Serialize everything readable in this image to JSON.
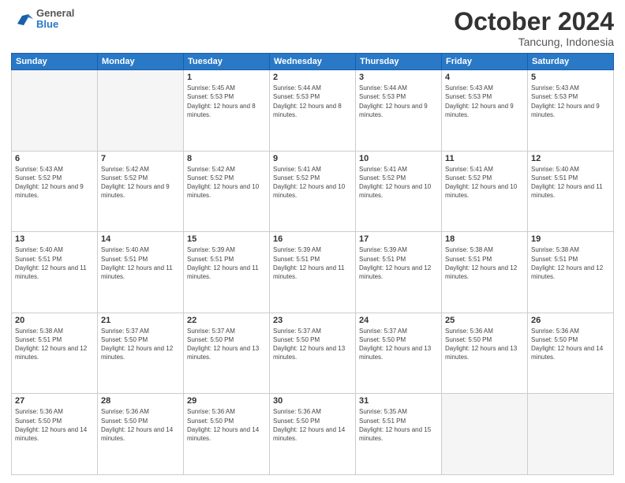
{
  "header": {
    "logo_general": "General",
    "logo_blue": "Blue",
    "month": "October 2024",
    "location": "Tancung, Indonesia"
  },
  "days_of_week": [
    "Sunday",
    "Monday",
    "Tuesday",
    "Wednesday",
    "Thursday",
    "Friday",
    "Saturday"
  ],
  "weeks": [
    [
      {
        "day": "",
        "sunrise": "",
        "sunset": "",
        "daylight": ""
      },
      {
        "day": "",
        "sunrise": "",
        "sunset": "",
        "daylight": ""
      },
      {
        "day": "1",
        "sunrise": "Sunrise: 5:45 AM",
        "sunset": "Sunset: 5:53 PM",
        "daylight": "Daylight: 12 hours and 8 minutes."
      },
      {
        "day": "2",
        "sunrise": "Sunrise: 5:44 AM",
        "sunset": "Sunset: 5:53 PM",
        "daylight": "Daylight: 12 hours and 8 minutes."
      },
      {
        "day": "3",
        "sunrise": "Sunrise: 5:44 AM",
        "sunset": "Sunset: 5:53 PM",
        "daylight": "Daylight: 12 hours and 9 minutes."
      },
      {
        "day": "4",
        "sunrise": "Sunrise: 5:43 AM",
        "sunset": "Sunset: 5:53 PM",
        "daylight": "Daylight: 12 hours and 9 minutes."
      },
      {
        "day": "5",
        "sunrise": "Sunrise: 5:43 AM",
        "sunset": "Sunset: 5:53 PM",
        "daylight": "Daylight: 12 hours and 9 minutes."
      }
    ],
    [
      {
        "day": "6",
        "sunrise": "Sunrise: 5:43 AM",
        "sunset": "Sunset: 5:52 PM",
        "daylight": "Daylight: 12 hours and 9 minutes."
      },
      {
        "day": "7",
        "sunrise": "Sunrise: 5:42 AM",
        "sunset": "Sunset: 5:52 PM",
        "daylight": "Daylight: 12 hours and 9 minutes."
      },
      {
        "day": "8",
        "sunrise": "Sunrise: 5:42 AM",
        "sunset": "Sunset: 5:52 PM",
        "daylight": "Daylight: 12 hours and 10 minutes."
      },
      {
        "day": "9",
        "sunrise": "Sunrise: 5:41 AM",
        "sunset": "Sunset: 5:52 PM",
        "daylight": "Daylight: 12 hours and 10 minutes."
      },
      {
        "day": "10",
        "sunrise": "Sunrise: 5:41 AM",
        "sunset": "Sunset: 5:52 PM",
        "daylight": "Daylight: 12 hours and 10 minutes."
      },
      {
        "day": "11",
        "sunrise": "Sunrise: 5:41 AM",
        "sunset": "Sunset: 5:52 PM",
        "daylight": "Daylight: 12 hours and 10 minutes."
      },
      {
        "day": "12",
        "sunrise": "Sunrise: 5:40 AM",
        "sunset": "Sunset: 5:51 PM",
        "daylight": "Daylight: 12 hours and 11 minutes."
      }
    ],
    [
      {
        "day": "13",
        "sunrise": "Sunrise: 5:40 AM",
        "sunset": "Sunset: 5:51 PM",
        "daylight": "Daylight: 12 hours and 11 minutes."
      },
      {
        "day": "14",
        "sunrise": "Sunrise: 5:40 AM",
        "sunset": "Sunset: 5:51 PM",
        "daylight": "Daylight: 12 hours and 11 minutes."
      },
      {
        "day": "15",
        "sunrise": "Sunrise: 5:39 AM",
        "sunset": "Sunset: 5:51 PM",
        "daylight": "Daylight: 12 hours and 11 minutes."
      },
      {
        "day": "16",
        "sunrise": "Sunrise: 5:39 AM",
        "sunset": "Sunset: 5:51 PM",
        "daylight": "Daylight: 12 hours and 11 minutes."
      },
      {
        "day": "17",
        "sunrise": "Sunrise: 5:39 AM",
        "sunset": "Sunset: 5:51 PM",
        "daylight": "Daylight: 12 hours and 12 minutes."
      },
      {
        "day": "18",
        "sunrise": "Sunrise: 5:38 AM",
        "sunset": "Sunset: 5:51 PM",
        "daylight": "Daylight: 12 hours and 12 minutes."
      },
      {
        "day": "19",
        "sunrise": "Sunrise: 5:38 AM",
        "sunset": "Sunset: 5:51 PM",
        "daylight": "Daylight: 12 hours and 12 minutes."
      }
    ],
    [
      {
        "day": "20",
        "sunrise": "Sunrise: 5:38 AM",
        "sunset": "Sunset: 5:51 PM",
        "daylight": "Daylight: 12 hours and 12 minutes."
      },
      {
        "day": "21",
        "sunrise": "Sunrise: 5:37 AM",
        "sunset": "Sunset: 5:50 PM",
        "daylight": "Daylight: 12 hours and 12 minutes."
      },
      {
        "day": "22",
        "sunrise": "Sunrise: 5:37 AM",
        "sunset": "Sunset: 5:50 PM",
        "daylight": "Daylight: 12 hours and 13 minutes."
      },
      {
        "day": "23",
        "sunrise": "Sunrise: 5:37 AM",
        "sunset": "Sunset: 5:50 PM",
        "daylight": "Daylight: 12 hours and 13 minutes."
      },
      {
        "day": "24",
        "sunrise": "Sunrise: 5:37 AM",
        "sunset": "Sunset: 5:50 PM",
        "daylight": "Daylight: 12 hours and 13 minutes."
      },
      {
        "day": "25",
        "sunrise": "Sunrise: 5:36 AM",
        "sunset": "Sunset: 5:50 PM",
        "daylight": "Daylight: 12 hours and 13 minutes."
      },
      {
        "day": "26",
        "sunrise": "Sunrise: 5:36 AM",
        "sunset": "Sunset: 5:50 PM",
        "daylight": "Daylight: 12 hours and 14 minutes."
      }
    ],
    [
      {
        "day": "27",
        "sunrise": "Sunrise: 5:36 AM",
        "sunset": "Sunset: 5:50 PM",
        "daylight": "Daylight: 12 hours and 14 minutes."
      },
      {
        "day": "28",
        "sunrise": "Sunrise: 5:36 AM",
        "sunset": "Sunset: 5:50 PM",
        "daylight": "Daylight: 12 hours and 14 minutes."
      },
      {
        "day": "29",
        "sunrise": "Sunrise: 5:36 AM",
        "sunset": "Sunset: 5:50 PM",
        "daylight": "Daylight: 12 hours and 14 minutes."
      },
      {
        "day": "30",
        "sunrise": "Sunrise: 5:36 AM",
        "sunset": "Sunset: 5:50 PM",
        "daylight": "Daylight: 12 hours and 14 minutes."
      },
      {
        "day": "31",
        "sunrise": "Sunrise: 5:35 AM",
        "sunset": "Sunset: 5:51 PM",
        "daylight": "Daylight: 12 hours and 15 minutes."
      },
      {
        "day": "",
        "sunrise": "",
        "sunset": "",
        "daylight": ""
      },
      {
        "day": "",
        "sunrise": "",
        "sunset": "",
        "daylight": ""
      }
    ]
  ]
}
